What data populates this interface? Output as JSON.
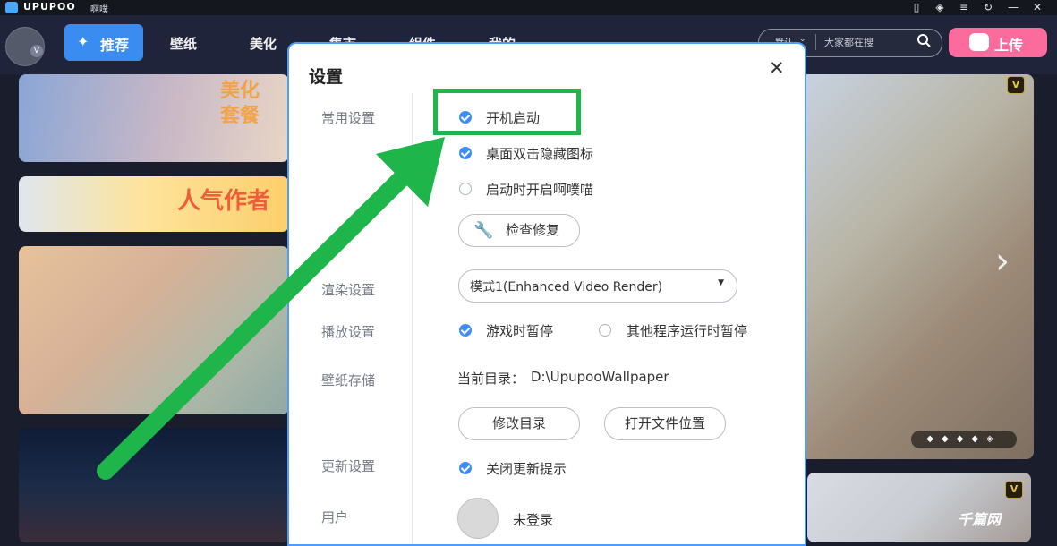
{
  "titlebar": {
    "app_name": "UPUPOO",
    "app_sub": "啊噗",
    "controls": [
      "phone-icon",
      "diamond-icon",
      "menu-icon",
      "refresh-icon",
      "minimize-icon",
      "close-icon"
    ]
  },
  "nav": {
    "active": "推荐",
    "items": [
      "壁纸",
      "美化",
      "集市",
      "组件",
      "我的"
    ]
  },
  "search": {
    "scope": "默认",
    "placeholder": "大家都在搜"
  },
  "upload_label": "上传",
  "banners": {
    "b1_text": "美化套餐",
    "b2_text": "人气作者"
  },
  "badges": {
    "v": "V"
  },
  "dialog": {
    "title": "设置",
    "sidebar": [
      "常用设置",
      "渲染设置",
      "播放设置",
      "壁纸存储",
      "更新设置",
      "用户"
    ],
    "general": {
      "options": [
        {
          "label": "开机启动",
          "checked": true
        },
        {
          "label": "桌面双击隐藏图标",
          "checked": true
        },
        {
          "label": "启动时开启啊噗喵",
          "checked": false
        }
      ],
      "repair_button": "检查修复"
    },
    "render": {
      "mode": "模式1(Enhanced Video Render)"
    },
    "play": {
      "game_pause": {
        "label": "游戏时暂停",
        "checked": true
      },
      "other_pause": {
        "label": "其他程序运行时暂停",
        "checked": false
      }
    },
    "storage": {
      "label": "当前目录：",
      "path": "D:\\UpupooWallpaper",
      "change_button": "修改目录",
      "open_button": "打开文件位置"
    },
    "update": {
      "close_prompt": {
        "label": "关闭更新提示",
        "checked": true
      }
    },
    "user": {
      "status": "未登录"
    }
  },
  "watermark": "千篇网",
  "colors": {
    "accent": "#3d8ef6",
    "upload": "#fb6b9b",
    "highlight": "#1eb54a",
    "header_bg": "#20243a"
  }
}
